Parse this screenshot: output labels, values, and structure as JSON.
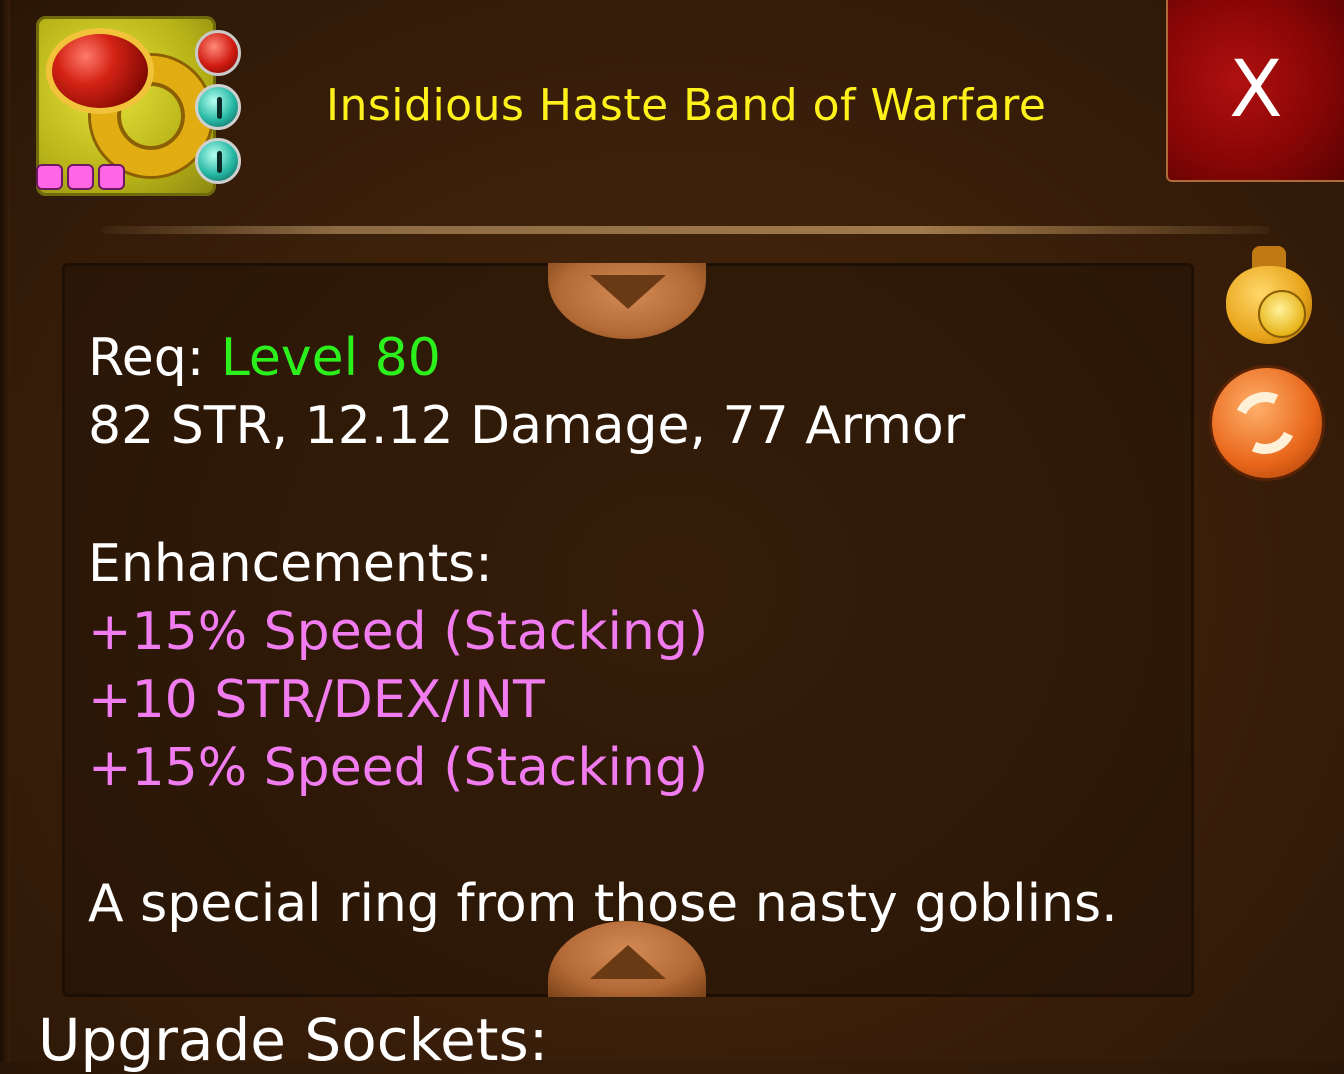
{
  "item": {
    "title": "Insidious Haste Band of Warfare",
    "socket_pips": 3,
    "gems": [
      "red-skull-gem",
      "teal-eye-gem",
      "teal-eye-gem"
    ]
  },
  "close_label": "X",
  "details": {
    "req_label": "Req:",
    "req_value": "Level 80",
    "stats": "82 STR, 12.12 Damage, 77 Armor",
    "enhancements_label": "Enhancements:",
    "enhancements": [
      "+15% Speed (Stacking)",
      "+10 STR/DEX/INT",
      "+15% Speed (Stacking)"
    ],
    "description": "A special ring from those nasty goblins."
  },
  "section_heading": "Upgrade Sockets:",
  "colors": {
    "title": "#fff21c",
    "requirement": "#2cf01c",
    "enhancement": "#f07cf0",
    "close_button": "#8a0606"
  },
  "icons": [
    "ring-item-icon",
    "money-bag-icon",
    "swap-icon",
    "scroll-up-icon",
    "scroll-down-icon"
  ]
}
